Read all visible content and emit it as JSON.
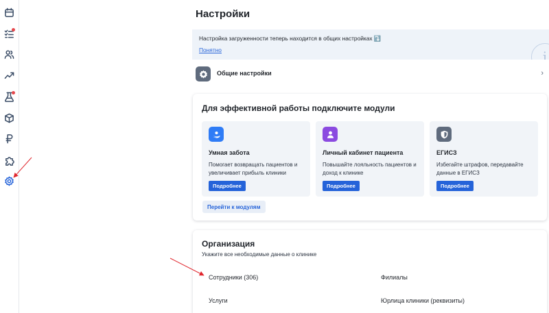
{
  "sidebar": {
    "items": [
      {
        "name": "calendar-icon"
      },
      {
        "name": "tasks-icon",
        "badge": true
      },
      {
        "name": "users-icon"
      },
      {
        "name": "analytics-icon"
      },
      {
        "name": "lab-flask-icon",
        "badge": true
      },
      {
        "name": "package-icon"
      },
      {
        "name": "ruble-icon"
      },
      {
        "name": "puzzle-icon"
      },
      {
        "name": "gear-icon",
        "active": true
      }
    ],
    "badge_color": "#e5484d"
  },
  "page": {
    "title": "Настройки"
  },
  "info_banner": {
    "text": "Настройка загруженности теперь находится в общих настройках ⤵️",
    "link": "Понятно",
    "icon": "info-icon",
    "icon_glyph": "i"
  },
  "general_settings": {
    "label": "Общие настройки",
    "chevron": "›"
  },
  "modules": {
    "title": "Для эффективной работы подключите модули",
    "items": [
      {
        "title": "Умная забота",
        "description": "Помогает возвращать пациентов и увеличивает прибыль клиники",
        "button": "Подробнее",
        "icon": "care-hand-icon",
        "color": "#2f7cf6"
      },
      {
        "title": "Личный кабинет пациента",
        "description": "Повышайте лояльность пациентов и доход к клинике",
        "button": "Подробнее",
        "icon": "patient-profile-icon",
        "color": "#8b4ae0"
      },
      {
        "title": "ЕГИСЗ",
        "description": "Избегайте штрафов, передавайте данные в ЕГИСЗ",
        "button": "Подробнее",
        "icon": "shield-icon",
        "color": "#5f6b7d"
      }
    ],
    "go_button": "Перейти к модулям"
  },
  "organization": {
    "title": "Организация",
    "subtitle": "Укажите все необходимые данные о клинике",
    "items": [
      {
        "label": "Сотрудники (306)"
      },
      {
        "label": "Филиалы"
      },
      {
        "label": "Услуги"
      },
      {
        "label": "Юрлица клиники (реквизиты)"
      }
    ]
  },
  "colors": {
    "accent": "#2563d9",
    "banner_bg": "#eef3f9",
    "annotation_arrow": "#e0262d"
  }
}
